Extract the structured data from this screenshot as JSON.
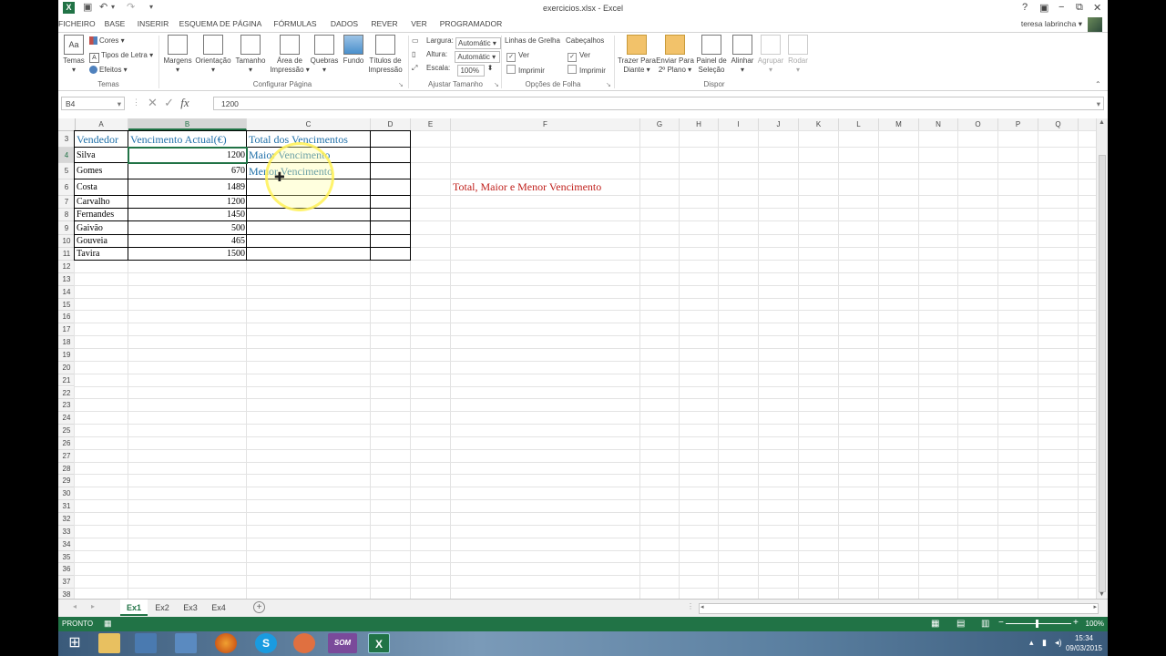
{
  "window": {
    "title": "exercicios.xlsx - Excel",
    "user": "teresa labrincha",
    "help": "?",
    "controls": [
      "−",
      "⧉",
      "✕"
    ]
  },
  "tabs": [
    {
      "label": "FICHEIRO",
      "state": "file"
    },
    {
      "label": "BASE",
      "state": ""
    },
    {
      "label": "INSERIR",
      "state": ""
    },
    {
      "label": "ESQUEMA DE PÁGINA",
      "state": "active"
    },
    {
      "label": "FÓRMULAS",
      "state": ""
    },
    {
      "label": "DADOS",
      "state": ""
    },
    {
      "label": "REVER",
      "state": ""
    },
    {
      "label": "VER",
      "state": ""
    },
    {
      "label": "PROGRAMADOR",
      "state": ""
    }
  ],
  "ribbon": {
    "temas": {
      "label": "Temas",
      "temas_btn": "Temas",
      "cores": "Cores ▾",
      "tipos": "Tipos de Letra ▾",
      "efeitos": "Efeitos ▾"
    },
    "configurar": {
      "label": "Configurar Página",
      "margens": "Margens",
      "orientacao": "Orientação",
      "tamanho": "Tamanho",
      "area_1": "Área de",
      "area_2": "Impressão",
      "quebras": "Quebras",
      "fundo": "Fundo",
      "titulos_1": "Títulos de",
      "titulos_2": "Impressão"
    },
    "ajustar": {
      "label": "Ajustar Tamanho",
      "largura": "Largura:",
      "largura_val": "Automátic ▾",
      "altura": "Altura:",
      "altura_val": "Automátic ▾",
      "escala": "Escala:",
      "escala_val": "100%"
    },
    "opcoes": {
      "label": "Opções de Folha",
      "linhas": "Linhas de Grelha",
      "cabecalhos": "Cabeçalhos",
      "ver": "Ver",
      "imprimir": "Imprimir"
    },
    "dispor": {
      "label": "Dispor",
      "trazer_1": "Trazer Para",
      "trazer_2": "Diante ▾",
      "enviar_1": "Enviar Para",
      "enviar_2": "2º Plano ▾",
      "painel_1": "Painel de",
      "painel_2": "Seleção",
      "alinhar": "Alinhar",
      "agrupar": "Agrupar",
      "rodar": "Rodar"
    }
  },
  "formula_bar": {
    "name_box": "B4",
    "value": "1200",
    "fx": "fx"
  },
  "columns": [
    "A",
    "B",
    "C",
    "D",
    "E",
    "F",
    "G",
    "H",
    "I",
    "J",
    "K",
    "L",
    "M",
    "N",
    "O",
    "P",
    "Q"
  ],
  "selected_column": "B",
  "selected_row": "4",
  "rows": [
    "3",
    "4",
    "5",
    "6",
    "7",
    "8",
    "9",
    "10",
    "11",
    "12",
    "13",
    "14",
    "15",
    "16",
    "17",
    "18",
    "19",
    "20",
    "21",
    "22",
    "23",
    "24",
    "25",
    "26",
    "27",
    "28",
    "29",
    "30",
    "31",
    "32",
    "33",
    "34",
    "35",
    "36",
    "37",
    "38"
  ],
  "sheet": {
    "header": {
      "a": "Vendedor",
      "b": "Vencimento Actual(€)",
      "c": "Total dos Vencimentos"
    },
    "labels": {
      "c4": "Maior Vencimento",
      "c5": "Menor Vencimento"
    },
    "data": [
      {
        "name": "Silva",
        "value": "1200"
      },
      {
        "name": "Gomes",
        "value": "670"
      },
      {
        "name": "Costa",
        "value": "1489"
      },
      {
        "name": "Carvalho",
        "value": "1200"
      },
      {
        "name": "Fernandes",
        "value": "1450"
      },
      {
        "name": "Gaivão",
        "value": "500"
      },
      {
        "name": "Gouveia",
        "value": "465"
      },
      {
        "name": "Tavira",
        "value": "1500"
      }
    ],
    "note": "Total, Maior e Menor Vencimento"
  },
  "sheet_tabs": [
    {
      "label": "Ex1",
      "active": true
    },
    {
      "label": "Ex2",
      "active": false
    },
    {
      "label": "Ex3",
      "active": false
    },
    {
      "label": "Ex4",
      "active": false
    }
  ],
  "status": {
    "mode": "PRONTO",
    "zoom": "100%"
  },
  "clock": {
    "time": "15:34",
    "date": "09/03/2015"
  },
  "colors": {
    "excel_green": "#217346",
    "header_blue": "#1f6fa8",
    "note_red": "#c0211d"
  }
}
